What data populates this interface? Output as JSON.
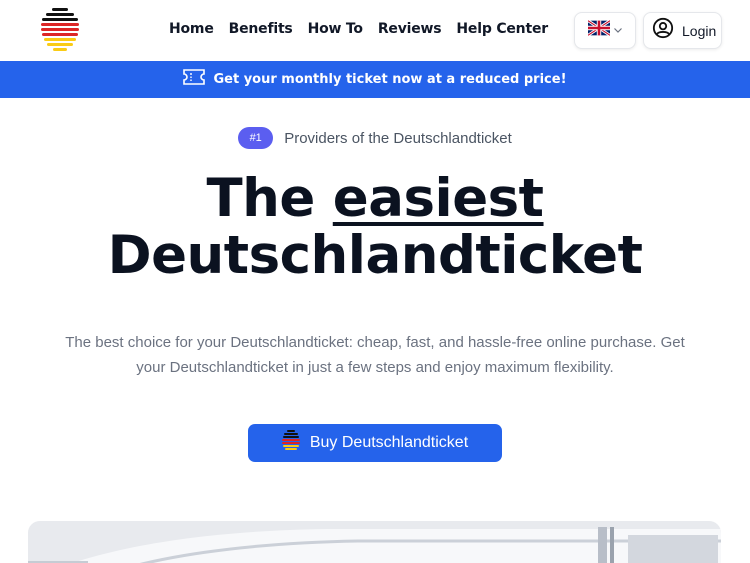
{
  "header": {
    "logo_icon": "germany-flag-logo-icon",
    "nav": [
      "Home",
      "Benefits",
      "How To",
      "Reviews",
      "Help Center"
    ],
    "language_icon": "uk-flag-icon",
    "language_chevron": "chevron-down-icon",
    "login_icon": "user-circle-icon",
    "login_label": "Login"
  },
  "banner": {
    "icon": "ticket-icon",
    "text": "Get your monthly ticket now at a reduced price!"
  },
  "hero": {
    "badge": "#1",
    "badge_text": "Providers of the Deutschlandticket",
    "title_pre": "The ",
    "title_emph": "easiest",
    "title_line2": "Deutschlandticket",
    "description": "The best choice for your Deutschlandticket: cheap, fast, and hassle-free online purchase. Get your Deutschlandticket in just a few steps and enjoy maximum flexibility.",
    "cta_icon": "germany-flag-icon",
    "cta_label": "Buy Deutschlandticket"
  },
  "colors": {
    "primary": "#2563eb",
    "badge": "#5b5ef0",
    "heading": "#0b1220",
    "muted": "#6b7280"
  },
  "media": {
    "hero_image_icon": "train-image"
  }
}
